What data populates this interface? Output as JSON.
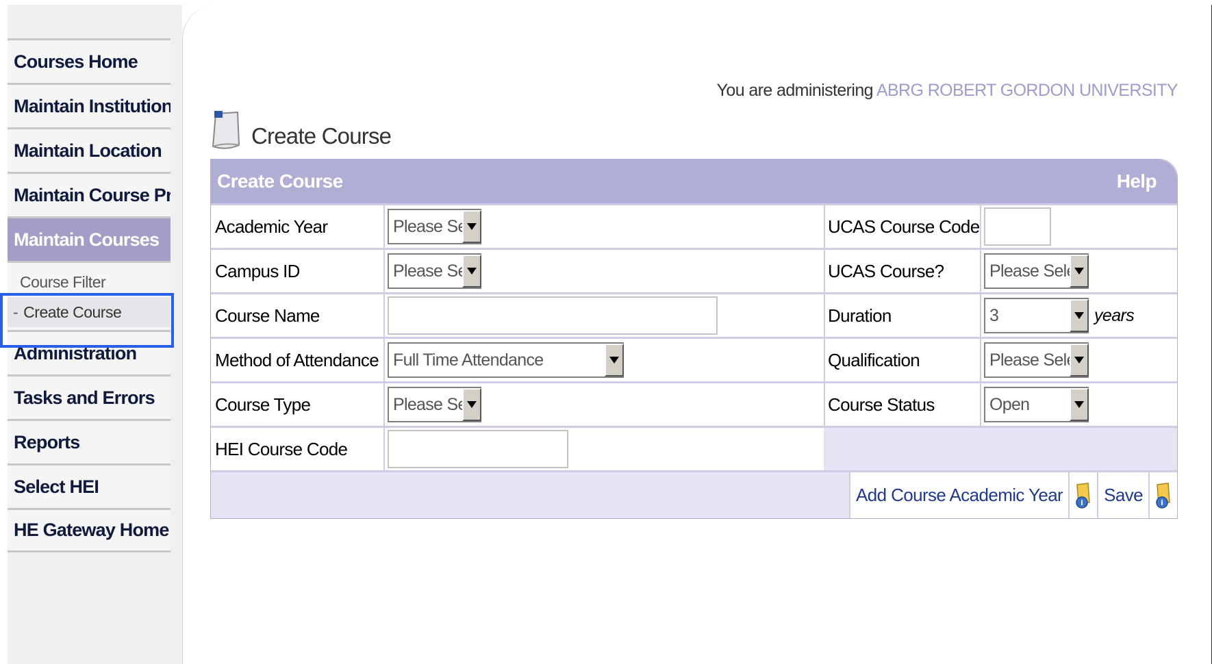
{
  "sidebar": {
    "items": [
      {
        "label": "Courses Home"
      },
      {
        "label": "Maintain Institution"
      },
      {
        "label": "Maintain Location"
      },
      {
        "label": "Maintain Course Profile"
      },
      {
        "label": "Maintain Courses"
      },
      {
        "label": "Administration"
      },
      {
        "label": "Tasks and Errors"
      },
      {
        "label": "Reports"
      },
      {
        "label": "Select HEI"
      },
      {
        "label": "HE Gateway Home"
      }
    ],
    "sub_items": [
      {
        "label": "Course Filter"
      },
      {
        "label": "Create Course",
        "prefix": "-"
      }
    ],
    "active_item": "Maintain Courses"
  },
  "header": {
    "admin_prefix": "You are administering",
    "institution": "ABRG ROBERT GORDON UNIVERSITY"
  },
  "page": {
    "title": "Create Course",
    "icon": "page-icon"
  },
  "panel": {
    "title": "Create Course",
    "help": "Help",
    "fields": {
      "academic_year": {
        "label": "Academic Year",
        "value": "Please Select"
      },
      "campus_id": {
        "label": "Campus ID",
        "value": "Please Select"
      },
      "course_name": {
        "label": "Course Name",
        "value": ""
      },
      "method_of_attendance": {
        "label": "Method of Attendance",
        "value": "Full Time Attendance"
      },
      "course_type": {
        "label": "Course Type",
        "value": "Please Select"
      },
      "hei_course_code": {
        "label": "HEI Course Code",
        "value": ""
      },
      "ucas_course_code": {
        "label": "UCAS Course Code",
        "value": ""
      },
      "ucas_course": {
        "label": "UCAS Course?",
        "value": "Please Select"
      },
      "duration": {
        "label": "Duration",
        "value": "3",
        "units": "years"
      },
      "qualification": {
        "label": "Qualification",
        "value": "Please Select"
      },
      "course_status": {
        "label": "Course Status",
        "value": "Open"
      }
    },
    "actions": {
      "add_year": "Add Course Academic Year",
      "save": "Save"
    }
  },
  "colors": {
    "nav_active": "#a69cc8",
    "panel_header": "#b1aed6",
    "institution_text": "#9c9ccf",
    "highlight": "#2a5ee8"
  }
}
